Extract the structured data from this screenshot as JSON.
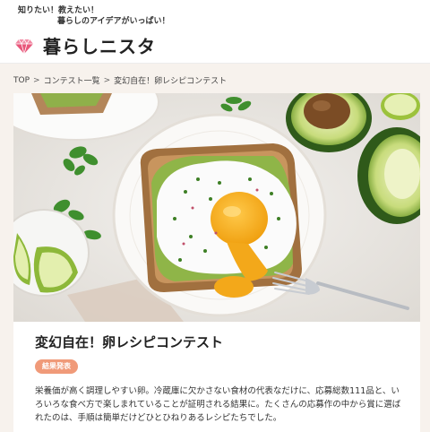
{
  "header": {
    "tagline_line1": "知りたい！教えたい！",
    "tagline_line2": "暮らしのアイデアがいっぱい！",
    "logo_text": "暮らしニスタ",
    "logo_icon": "diamond-icon",
    "accent_color": "#e8567a"
  },
  "breadcrumb": {
    "items": [
      "TOP",
      "コンテスト一覧",
      "変幻自在！卵レシピコンテスト"
    ],
    "separator": ">"
  },
  "contest": {
    "title": "変幻自在！卵レシピコンテスト",
    "status_badge": "結果発表",
    "badge_color": "#f09a79",
    "description": "栄養価が高く調理しやすい卵。冷蔵庫に欠かさない食材の代表なだけに、応募総数111品と、いろいろな食べ方で楽しまれていることが証明される結果に。たくさんの応募作の中から賞に選ばれたのは、手順は簡単だけどひとひねりあるレシピたちでした。"
  }
}
